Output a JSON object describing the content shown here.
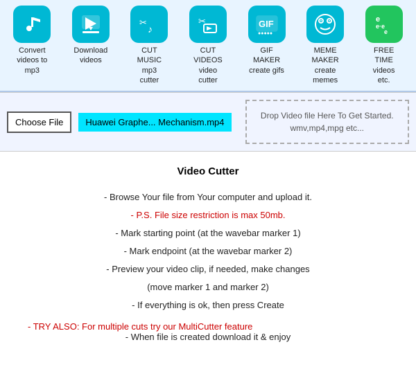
{
  "nav": {
    "items": [
      {
        "id": "mp3",
        "icon_class": "icon-mp3",
        "icon_symbol": "♪",
        "label": "Convert\nvideos to\nmp3"
      },
      {
        "id": "download",
        "icon_class": "icon-download",
        "icon_symbol": "▶",
        "label": "Download\nvideos"
      },
      {
        "id": "cut-music",
        "icon_class": "icon-cut-music",
        "icon_symbol": "✂♪",
        "label": "CUT\nMUSIC\nmp3\ncutter"
      },
      {
        "id": "cut-video",
        "icon_class": "icon-cut-video",
        "icon_symbol": "✂▶",
        "label": "CUT\nVIDEOS\nvideo\ncutter"
      },
      {
        "id": "gif",
        "icon_class": "icon-gif",
        "icon_symbol": "GIF",
        "label": "GIF\nMAKER\ncreate gifs"
      },
      {
        "id": "meme",
        "icon_class": "icon-meme",
        "icon_symbol": "☺",
        "label": "MEME\nMAKER\ncreate\nmemes"
      },
      {
        "id": "free",
        "icon_class": "icon-free",
        "icon_symbol": "e\ne·e",
        "label": "FREE\nTIME\nvideos\netc."
      }
    ]
  },
  "file_input": {
    "button_label": "Choose File",
    "file_name": "Huawei Graphe... Mechanism.mp4",
    "drop_text": "Drop Video file Here To Get Started.\nwmv,mp4,mpg etc..."
  },
  "content": {
    "title": "Video Cutter",
    "instructions": [
      "- Browse Your file from Your computer and upload it.",
      "- P.S. File size restriction is max 50mb.",
      "- Mark starting point (at the wavebar marker 1)",
      "- Mark endpoint (at the wavebar marker 2)",
      "- Preview your video clip, if needed, make changes",
      "(move marker 1 and marker 2)",
      "- If everything is ok, then press Create"
    ],
    "try_also": "- TRY ALSO: For multiple cuts try our MultiCutter feature",
    "last_line": "- When file is created download it & enjoy"
  }
}
